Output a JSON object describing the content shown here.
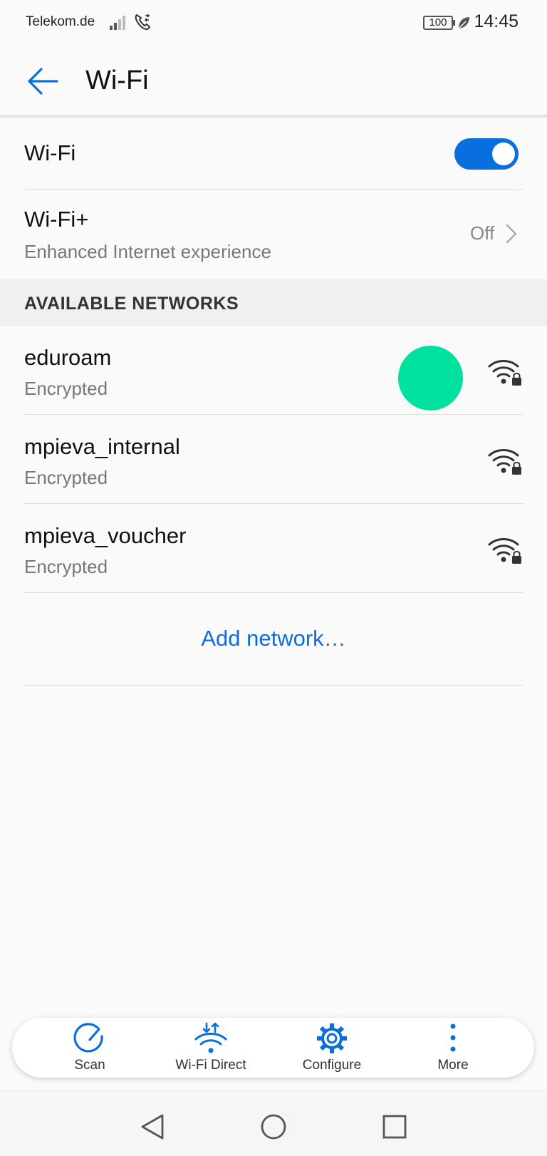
{
  "status_bar": {
    "carrier": "Telekom.de",
    "battery": "100",
    "time": "14:45"
  },
  "header": {
    "title": "Wi-Fi",
    "back_icon": "arrow-left-icon"
  },
  "wifi_toggle": {
    "label": "Wi-Fi",
    "enabled": true
  },
  "wifi_plus": {
    "title": "Wi-Fi+",
    "subtitle": "Enhanced Internet experience",
    "value": "Off"
  },
  "networks_section": {
    "title": "AVAILABLE NETWORKS",
    "items": [
      {
        "name": "eduroam",
        "status": "Encrypted"
      },
      {
        "name": "mpieva_internal",
        "status": "Encrypted"
      },
      {
        "name": "mpieva_voucher",
        "status": "Encrypted"
      }
    ]
  },
  "add_network": {
    "label": "Add network…"
  },
  "toolbar": {
    "scan": "Scan",
    "wifi_direct": "Wi-Fi Direct",
    "configure": "Configure",
    "more": "More"
  },
  "colors": {
    "accent": "#0a6fde",
    "touch_indicator": "#00e09e"
  }
}
